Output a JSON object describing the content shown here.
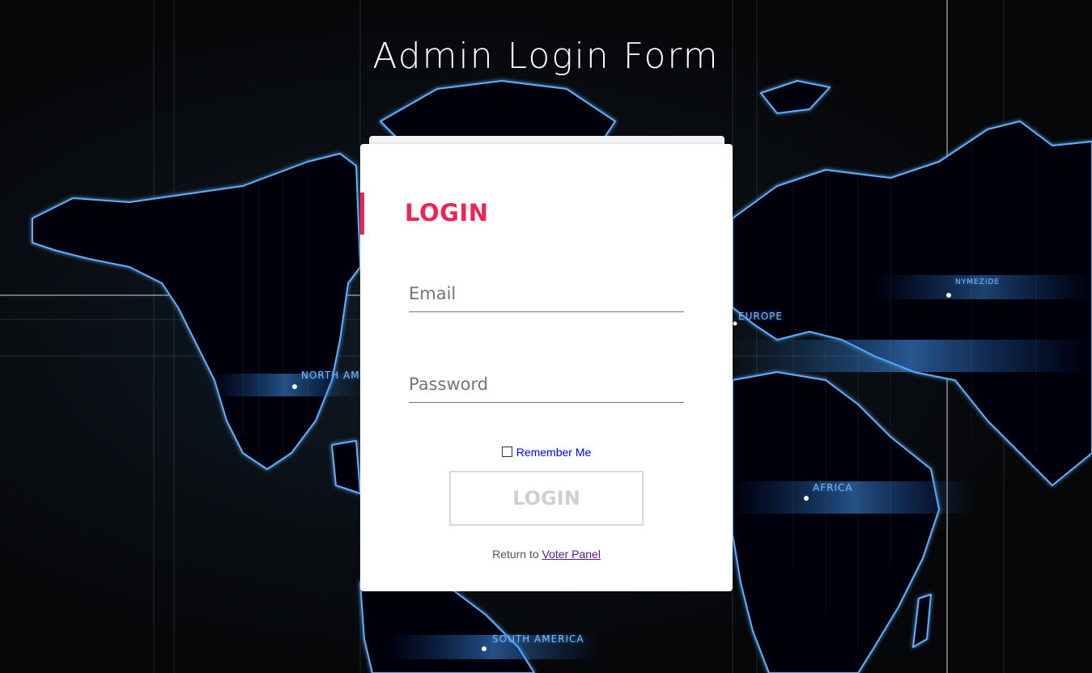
{
  "page": {
    "title": "Admin Login Form"
  },
  "background": {
    "labels": {
      "north_america": "NORTH AM",
      "europe": "EUROPE",
      "asia": "NYMEZIDE",
      "africa": "AFRICA",
      "south_america": "SOUTH AMERICA"
    },
    "glow_color": "#2f7fd8"
  },
  "login_card": {
    "heading": "LOGIN",
    "accent_color": "#ed2553",
    "email": {
      "placeholder": "Email",
      "value": ""
    },
    "password": {
      "placeholder": "Password",
      "value": ""
    },
    "remember_me": {
      "label": "Remember Me",
      "checked": false
    },
    "submit_label": "LOGIN",
    "return_text": "Return to",
    "return_link": "Voter Panel"
  }
}
